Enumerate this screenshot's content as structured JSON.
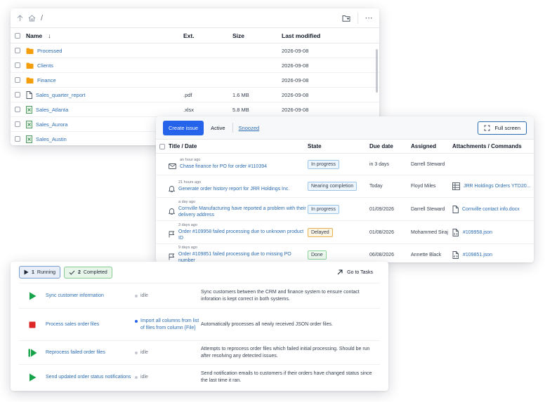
{
  "files": {
    "path": "/",
    "columns": [
      "Name",
      "Ext.",
      "Size",
      "Last modified"
    ],
    "sort_arrow": "↓",
    "rows": [
      {
        "name": "Processed",
        "type": "folder",
        "ext": "",
        "size": "",
        "modified": "2026-09-08"
      },
      {
        "name": "Clients",
        "type": "folder",
        "ext": "",
        "size": "",
        "modified": "2026-09-08"
      },
      {
        "name": "Finance",
        "type": "folder",
        "ext": "",
        "size": "",
        "modified": "2026-09-08"
      },
      {
        "name": "Sales_quarter_report",
        "type": "document",
        "ext": ".pdf",
        "size": "1.6 MB",
        "modified": "2026-09-08"
      },
      {
        "name": "Sales_Atlanta",
        "type": "spreadsheet",
        "ext": ".xlsx",
        "size": "5.8 MB",
        "modified": "2026-09-08"
      },
      {
        "name": "Sales_Aurora",
        "type": "spreadsheet",
        "ext": "",
        "size": "",
        "modified": ""
      },
      {
        "name": "Sales_Austin",
        "type": "spreadsheet",
        "ext": "",
        "size": "",
        "modified": ""
      }
    ]
  },
  "issues": {
    "create_label": "Create issue",
    "tab_active": "Active",
    "tab_snoozed": "Snoozed",
    "fullscreen_label": "Full screen",
    "columns": [
      "Title / Date",
      "State",
      "Due date",
      "Assigned",
      "Attachments / Commands"
    ],
    "rows": [
      {
        "time": "an hour ago",
        "title": "Chase finance for PO for order #110394",
        "icon": "mail-icon",
        "state": "In progress",
        "state_kind": "info",
        "due": "in 3 days",
        "assigned": "Darrell Steward",
        "attachment": "",
        "attachment_icon": ""
      },
      {
        "time": "21 hours ago",
        "title": "Generate order history report for JRR Holdings Inc.",
        "icon": "bell-icon",
        "state": "Nearing completion",
        "state_kind": "info",
        "due": "Today",
        "assigned": "Floyd Miles",
        "attachment": "JRR Holdings Orders YTD20...",
        "attachment_icon": "table-icon"
      },
      {
        "time": "a day ago",
        "title": "Cornville Manufacturing have reported a problem with their delivery address",
        "icon": "bell-icon",
        "state": "In progress",
        "state_kind": "info",
        "due": "01/09/2026",
        "assigned": "Darrell Steward",
        "attachment": "Cornville contact info.docx",
        "attachment_icon": "document-icon"
      },
      {
        "time": "3 days ago",
        "title": "Order #109958 failed processing due to unknown product ID",
        "icon": "flag-icon",
        "state": "Delayed",
        "state_kind": "warn",
        "due": "01/08/2026",
        "assigned": "Mohammed Siraj",
        "attachment": "#109958.json",
        "attachment_icon": "code-file-icon"
      },
      {
        "time": "9 days ago",
        "title": "Order #109851 failed processing due to missing PO number",
        "icon": "flag-icon",
        "state": "Done",
        "state_kind": "done",
        "due": "06/08/2026",
        "assigned": "Annette Black",
        "attachment": "#109851.json",
        "attachment_icon": "code-file-icon"
      }
    ]
  },
  "tasks": {
    "running_count": "1",
    "running_label": "Running",
    "completed_count": "2",
    "completed_label": "Completed",
    "goto_label": "Go to Tasks",
    "rows": [
      {
        "icon": "play-icon",
        "name": "Sync customer information",
        "status": "idle",
        "active": false,
        "desc": "Sync customers between the CRM and finance system to ensure contact inforation is kept correct in both systems."
      },
      {
        "icon": "stop-icon",
        "name": "Process sales order files",
        "status": "Import all columns from list of files from column {File}",
        "active": true,
        "desc": "Automatically processes all newly received JSON order files."
      },
      {
        "icon": "step-forward-icon",
        "name": "Reprocess failed order files",
        "status": "idle",
        "active": false,
        "desc": "Attempts to reprocess order files which failed initial processing. Should be run after resolving any detected issues."
      },
      {
        "icon": "play-icon",
        "name": "Send updated order status notifications",
        "status": "idle",
        "active": false,
        "desc": "Send notification emails to customers if their orders have changed status since the last time it ran."
      }
    ]
  },
  "colors": {
    "accent": "#2563eb",
    "link": "#2b6cb0",
    "folder": "#f59e0b",
    "play": "#16a34a",
    "stop": "#dc2626"
  }
}
